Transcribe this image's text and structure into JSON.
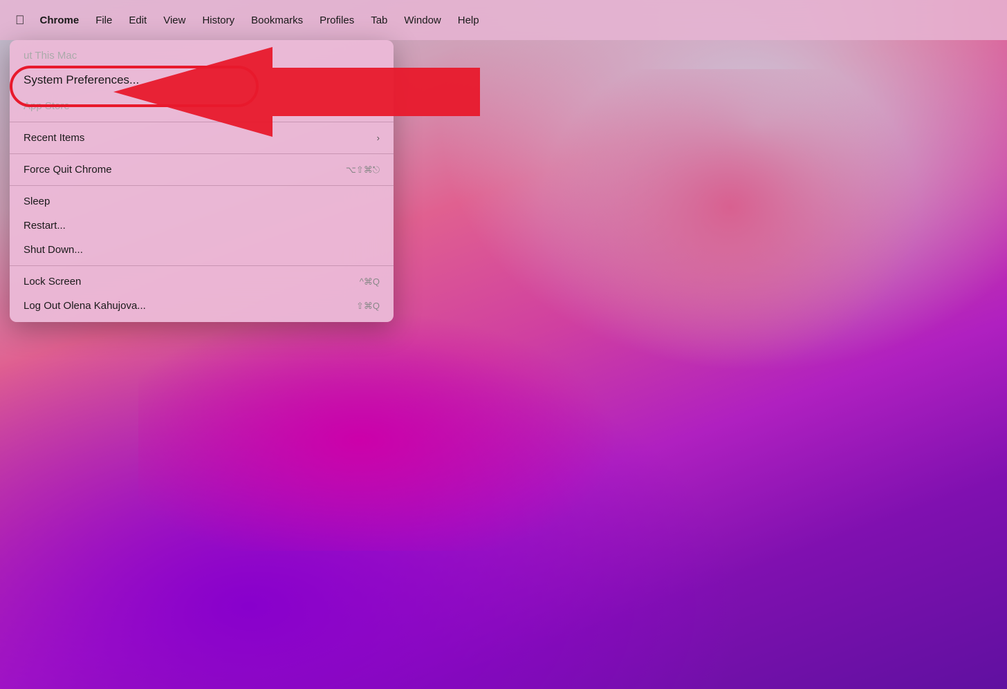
{
  "desktop": {
    "bg_description": "macOS Big Sur wallpaper - purple pink gradient"
  },
  "menubar": {
    "apple_icon": "🍎",
    "items": [
      {
        "id": "chrome",
        "label": "Chrome",
        "bold": true
      },
      {
        "id": "file",
        "label": "File"
      },
      {
        "id": "edit",
        "label": "Edit"
      },
      {
        "id": "view",
        "label": "View"
      },
      {
        "id": "history",
        "label": "History"
      },
      {
        "id": "bookmarks",
        "label": "Bookmarks"
      },
      {
        "id": "profiles",
        "label": "Profiles"
      },
      {
        "id": "tab",
        "label": "Tab"
      },
      {
        "id": "window",
        "label": "Window"
      },
      {
        "id": "help",
        "label": "Help"
      }
    ]
  },
  "apple_menu": {
    "items": [
      {
        "id": "about",
        "label": "About This Mac",
        "partial": true,
        "visible_text": "ut This Mac"
      },
      {
        "id": "system_prefs",
        "label": "System Preferences...",
        "highlighted": true
      },
      {
        "id": "app_store",
        "label": "App Store",
        "partial": true,
        "visible_text": "App Store"
      },
      {
        "separator1": true
      },
      {
        "id": "recent_items",
        "label": "Recent Items",
        "has_arrow": true
      },
      {
        "separator2": true
      },
      {
        "id": "force_quit",
        "label": "Force Quit Chrome",
        "shortcut": "⌥⇧⌘⎋"
      },
      {
        "separator3": true
      },
      {
        "id": "sleep",
        "label": "Sleep"
      },
      {
        "id": "restart",
        "label": "Restart..."
      },
      {
        "id": "shut_down",
        "label": "Shut Down..."
      },
      {
        "separator4": true
      },
      {
        "id": "lock_screen",
        "label": "Lock Screen",
        "shortcut": "^⌘Q"
      },
      {
        "id": "log_out",
        "label": "Log Out Olena Kahujova...",
        "shortcut": "⇧⌘Q"
      }
    ]
  },
  "annotation": {
    "circle_label": "System Preferences circled in red",
    "arrow_label": "Red arrow pointing to System Preferences"
  }
}
